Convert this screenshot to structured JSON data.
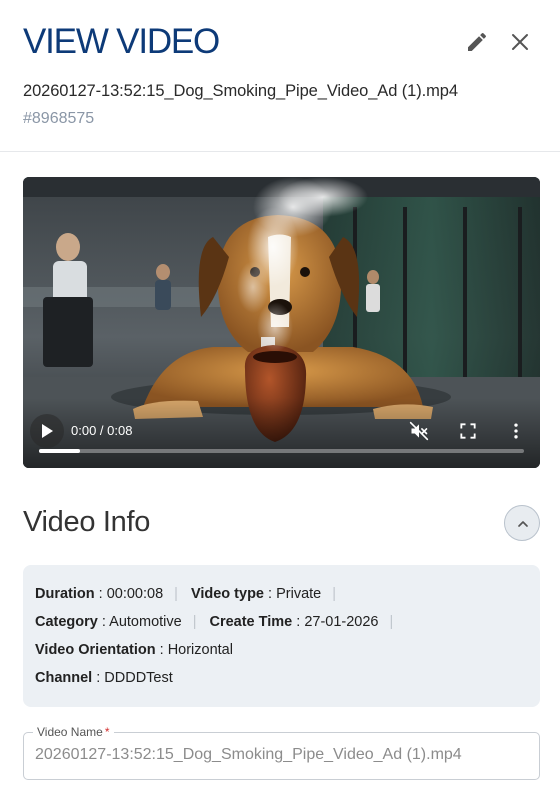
{
  "header": {
    "title": "VIEW VIDEO",
    "filename": "20260127-13:52:15_Dog_Smoking_Pipe_Video_Ad (1).mp4",
    "video_id": "#8968575",
    "edit_icon": "pencil-icon",
    "close_icon": "close-icon"
  },
  "player": {
    "time_display": "0:00 / 0:08",
    "progress_buffered": 0.085,
    "icons": [
      "play-icon",
      "muted-volume-icon",
      "fullscreen-icon",
      "more-vertical-icon"
    ]
  },
  "info_section": {
    "title": "Video Info",
    "toggle_icon": "chevron-up-icon",
    "rows": [
      [
        {
          "key": "Duration",
          "value": "00:00:08"
        },
        {
          "key": "Video type",
          "value": "Private"
        }
      ],
      [
        {
          "key": "Category",
          "value": "Automotive"
        },
        {
          "key": "Create Time",
          "value": "27-01-2026"
        }
      ],
      [
        {
          "key": "Video Orientation",
          "value": "Horizontal"
        }
      ],
      [
        {
          "key": "Channel",
          "value": "DDDDTest"
        }
      ]
    ]
  },
  "video_name_field": {
    "label": "Video Name",
    "required_mark": "*",
    "value": "20260127-13:52:15_Dog_Smoking_Pipe_Video_Ad (1).mp4"
  },
  "colors": {
    "title": "#0d3a78",
    "id_text": "#8a96a6",
    "info_bg": "#ecf0f4",
    "required": "#d32f2f"
  }
}
